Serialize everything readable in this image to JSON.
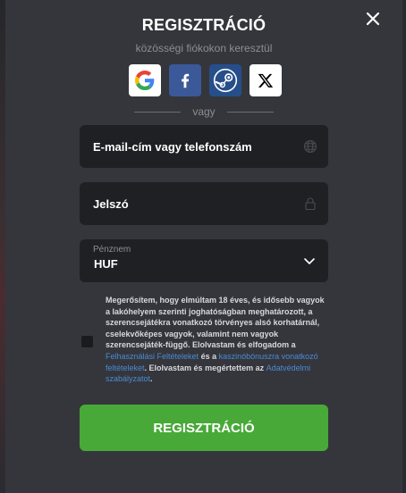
{
  "modal": {
    "title": "REGISZTRÁCIÓ",
    "subtitle": "közösségi fiókokon keresztül",
    "divider": "vagy"
  },
  "social": [
    {
      "name": "google",
      "icon": "google-icon"
    },
    {
      "name": "facebook",
      "icon": "facebook-icon"
    },
    {
      "name": "steam",
      "icon": "steam-icon"
    },
    {
      "name": "x",
      "icon": "x-icon"
    }
  ],
  "fields": {
    "email_placeholder": "E-mail-cím vagy telefonszám",
    "password_placeholder": "Jelszó",
    "currency_label": "Pénznem",
    "currency_value": "HUF"
  },
  "terms": {
    "part1": "Megerősítem, hogy elmúltam 18 éves, és idősebb vagyok a lakóhelyem szerinti joghatóságban meghatározott, a szerencsejátékra vonatkozó törvényes alsó korhatárnál, cselekvőképes vagyok, valamint nem vagyok szerencsejáték-függő. Elolvastam és elfogadom a ",
    "link1": "Felhasználási Feltételeket",
    "part2": " és a ",
    "link2": "kaszinóbónuszra vonatkozó feltételeket",
    "part3": ". Elolvastam és megértettem az ",
    "link3": "Adatvédelmi szabályzatot",
    "part4": "."
  },
  "submit_label": "REGISZTRÁCIÓ",
  "colors": {
    "modal_bg": "#35363c",
    "field_bg": "#1f2024",
    "accent_green": "#48a938",
    "link_blue": "#4a8ad4"
  }
}
